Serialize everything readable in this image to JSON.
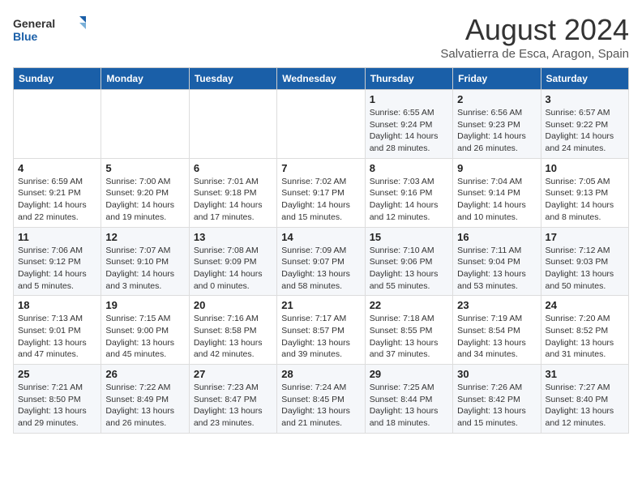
{
  "logo": {
    "text_general": "General",
    "text_blue": "Blue"
  },
  "header": {
    "month": "August 2024",
    "location": "Salvatierra de Esca, Aragon, Spain"
  },
  "weekdays": [
    "Sunday",
    "Monday",
    "Tuesday",
    "Wednesday",
    "Thursday",
    "Friday",
    "Saturday"
  ],
  "weeks": [
    [
      {
        "day": "",
        "info": ""
      },
      {
        "day": "",
        "info": ""
      },
      {
        "day": "",
        "info": ""
      },
      {
        "day": "",
        "info": ""
      },
      {
        "day": "1",
        "info": "Sunrise: 6:55 AM\nSunset: 9:24 PM\nDaylight: 14 hours\nand 28 minutes."
      },
      {
        "day": "2",
        "info": "Sunrise: 6:56 AM\nSunset: 9:23 PM\nDaylight: 14 hours\nand 26 minutes."
      },
      {
        "day": "3",
        "info": "Sunrise: 6:57 AM\nSunset: 9:22 PM\nDaylight: 14 hours\nand 24 minutes."
      }
    ],
    [
      {
        "day": "4",
        "info": "Sunrise: 6:59 AM\nSunset: 9:21 PM\nDaylight: 14 hours\nand 22 minutes."
      },
      {
        "day": "5",
        "info": "Sunrise: 7:00 AM\nSunset: 9:20 PM\nDaylight: 14 hours\nand 19 minutes."
      },
      {
        "day": "6",
        "info": "Sunrise: 7:01 AM\nSunset: 9:18 PM\nDaylight: 14 hours\nand 17 minutes."
      },
      {
        "day": "7",
        "info": "Sunrise: 7:02 AM\nSunset: 9:17 PM\nDaylight: 14 hours\nand 15 minutes."
      },
      {
        "day": "8",
        "info": "Sunrise: 7:03 AM\nSunset: 9:16 PM\nDaylight: 14 hours\nand 12 minutes."
      },
      {
        "day": "9",
        "info": "Sunrise: 7:04 AM\nSunset: 9:14 PM\nDaylight: 14 hours\nand 10 minutes."
      },
      {
        "day": "10",
        "info": "Sunrise: 7:05 AM\nSunset: 9:13 PM\nDaylight: 14 hours\nand 8 minutes."
      }
    ],
    [
      {
        "day": "11",
        "info": "Sunrise: 7:06 AM\nSunset: 9:12 PM\nDaylight: 14 hours\nand 5 minutes."
      },
      {
        "day": "12",
        "info": "Sunrise: 7:07 AM\nSunset: 9:10 PM\nDaylight: 14 hours\nand 3 minutes."
      },
      {
        "day": "13",
        "info": "Sunrise: 7:08 AM\nSunset: 9:09 PM\nDaylight: 14 hours\nand 0 minutes."
      },
      {
        "day": "14",
        "info": "Sunrise: 7:09 AM\nSunset: 9:07 PM\nDaylight: 13 hours\nand 58 minutes."
      },
      {
        "day": "15",
        "info": "Sunrise: 7:10 AM\nSunset: 9:06 PM\nDaylight: 13 hours\nand 55 minutes."
      },
      {
        "day": "16",
        "info": "Sunrise: 7:11 AM\nSunset: 9:04 PM\nDaylight: 13 hours\nand 53 minutes."
      },
      {
        "day": "17",
        "info": "Sunrise: 7:12 AM\nSunset: 9:03 PM\nDaylight: 13 hours\nand 50 minutes."
      }
    ],
    [
      {
        "day": "18",
        "info": "Sunrise: 7:13 AM\nSunset: 9:01 PM\nDaylight: 13 hours\nand 47 minutes."
      },
      {
        "day": "19",
        "info": "Sunrise: 7:15 AM\nSunset: 9:00 PM\nDaylight: 13 hours\nand 45 minutes."
      },
      {
        "day": "20",
        "info": "Sunrise: 7:16 AM\nSunset: 8:58 PM\nDaylight: 13 hours\nand 42 minutes."
      },
      {
        "day": "21",
        "info": "Sunrise: 7:17 AM\nSunset: 8:57 PM\nDaylight: 13 hours\nand 39 minutes."
      },
      {
        "day": "22",
        "info": "Sunrise: 7:18 AM\nSunset: 8:55 PM\nDaylight: 13 hours\nand 37 minutes."
      },
      {
        "day": "23",
        "info": "Sunrise: 7:19 AM\nSunset: 8:54 PM\nDaylight: 13 hours\nand 34 minutes."
      },
      {
        "day": "24",
        "info": "Sunrise: 7:20 AM\nSunset: 8:52 PM\nDaylight: 13 hours\nand 31 minutes."
      }
    ],
    [
      {
        "day": "25",
        "info": "Sunrise: 7:21 AM\nSunset: 8:50 PM\nDaylight: 13 hours\nand 29 minutes."
      },
      {
        "day": "26",
        "info": "Sunrise: 7:22 AM\nSunset: 8:49 PM\nDaylight: 13 hours\nand 26 minutes."
      },
      {
        "day": "27",
        "info": "Sunrise: 7:23 AM\nSunset: 8:47 PM\nDaylight: 13 hours\nand 23 minutes."
      },
      {
        "day": "28",
        "info": "Sunrise: 7:24 AM\nSunset: 8:45 PM\nDaylight: 13 hours\nand 21 minutes."
      },
      {
        "day": "29",
        "info": "Sunrise: 7:25 AM\nSunset: 8:44 PM\nDaylight: 13 hours\nand 18 minutes."
      },
      {
        "day": "30",
        "info": "Sunrise: 7:26 AM\nSunset: 8:42 PM\nDaylight: 13 hours\nand 15 minutes."
      },
      {
        "day": "31",
        "info": "Sunrise: 7:27 AM\nSunset: 8:40 PM\nDaylight: 13 hours\nand 12 minutes."
      }
    ]
  ]
}
